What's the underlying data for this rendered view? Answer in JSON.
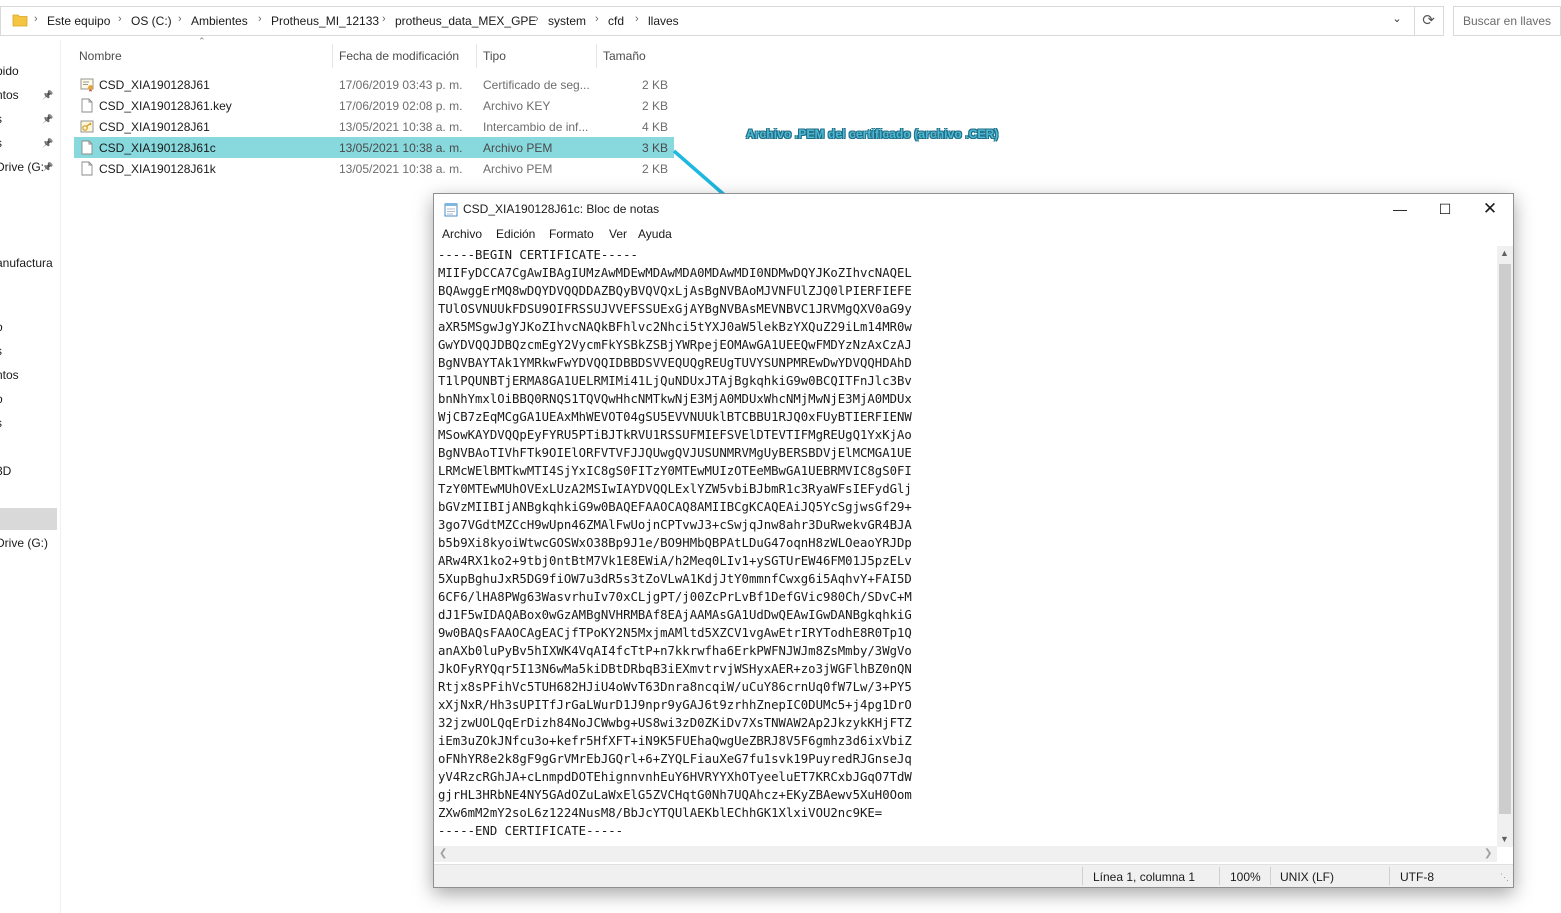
{
  "address": {
    "crumbs": [
      "Este equipo",
      "OS (C:)",
      "Ambientes",
      "Protheus_MI_12133",
      "protheus_data_MEX_GPE",
      "system",
      "cfd",
      "llaves"
    ],
    "search_placeholder": "Buscar en llaves"
  },
  "nav": {
    "items": [
      "pido",
      "ntos",
      "s",
      "s",
      "Drive (G:",
      "anufactura",
      "o",
      "s",
      "ntos",
      "o",
      "s",
      "3D",
      "Drive (G:)"
    ]
  },
  "columns": {
    "name": "Nombre",
    "date": "Fecha de modificación",
    "type": "Tipo",
    "size": "Tamaño"
  },
  "files": [
    {
      "name": "CSD_XIA190128J61",
      "date": "17/06/2019 03:43 p. m.",
      "type": "Certificado de seg...",
      "size": "2 KB",
      "icon": "certificate-icon"
    },
    {
      "name": "CSD_XIA190128J61.key",
      "date": "17/06/2019 02:08 p. m.",
      "type": "Archivo KEY",
      "size": "2 KB",
      "icon": "file-icon"
    },
    {
      "name": "CSD_XIA190128J61",
      "date": "13/05/2021 10:38 a. m.",
      "type": "Intercambio de inf...",
      "size": "4 KB",
      "icon": "pfx-icon"
    },
    {
      "name": "CSD_XIA190128J61c",
      "date": "13/05/2021 10:38 a. m.",
      "type": "Archivo PEM",
      "size": "3 KB",
      "icon": "file-icon",
      "selected": true
    },
    {
      "name": "CSD_XIA190128J61k",
      "date": "13/05/2021 10:38 a. m.",
      "type": "Archivo PEM",
      "size": "2 KB",
      "icon": "file-icon"
    }
  ],
  "annotation": "Archivo .PEM del certificado (archivo .CER)",
  "notepad": {
    "title": "CSD_XIA190128J61c: Bloc de notas",
    "menu": [
      "Archivo",
      "Edición",
      "Formato",
      "Ver",
      "Ayuda"
    ],
    "lines": [
      "-----BEGIN CERTIFICATE-----",
      "MIIFyDCCA7CgAwIBAgIUMzAwMDEwMDAwMDA0MDAwMDI0NDMwDQYJKoZIhvcNAQEL",
      "BQAwggErMQ8wDQYDVQQDDAZBQyBVQVQxLjAsBgNVBAoMJVNFUlZJQ0lPIERFIEFE",
      "TUlOSVNUUkFDSU9OIFRSSUJVVEFSSUExGjAYBgNVBAsMEVNBVC1JRVMgQXV0aG9y",
      "aXR5MSgwJgYJKoZIhvcNAQkBFhlvc2Nhci5tYXJ0aW5lekBzYXQuZ29iLm14MR0w",
      "GwYDVQQJDBQzcmEgY2VycmFkYSBkZSBjYWRpejEOMAwGA1UEEQwFMDYzNzAxCzAJ",
      "BgNVBAYTAk1YMRkwFwYDVQQIDBBDSVVEQUQgREUgTUVYSUNPMREwDwYDVQQHDAhD",
      "T1lPQUNBTjERMA8GA1UELRMIMi41LjQuNDUxJTAjBgkqhkiG9w0BCQITFnJlc3Bv",
      "bnNhYmxlOiBBQ0RNQS1TQVQwHhcNMTkwNjE3MjA0MDUxWhcNMjMwNjE3MjA0MDUx",
      "WjCB7zEqMCgGA1UEAxMhWEVOT04gSU5EVVNUUklBTCBBU1RJQ0xFUyBTIERFIENW",
      "MSowKAYDVQQpEyFYRU5PTiBJTkRVU1RSSUFMIEFSVElDTEVTIFMgREUgQ1YxKjAo",
      "BgNVBAoTIVhFTk9OIElORFVTVFJJQUwgQVJUSUNMRVMgUyBERSBDVjElMCMGA1UE",
      "LRMcWElBMTkwMTI4SjYxIC8gS0FITzY0MTEwMUIzOTEeMBwGA1UEBRMVIC8gS0FI",
      "TzY0MTEwMUhOVExLUzA2MSIwIAYDVQQLExlYZW5vbiBJbmR1c3RyaWFsIEFydGlj",
      "bGVzMIIBIjANBgkqhkiG9w0BAQEFAAOCAQ8AMIIBCgKCAQEAiJQ5YcSgjwsGf29+",
      "3go7VGdtMZCcH9wUpn46ZMAlFwUojnCPTvwJ3+cSwjqJnw8ahr3DuRwekvGR4BJA",
      "b5b9Xi8kyoiWtwcGOSWxO38Bp9J1e/BO9HMbQBPAtLDuG47oqnH8zWLOeaoYRJDp",
      "ARw4RX1ko2+9tbj0ntBtM7Vk1E8EWiA/h2Meq0LIv1+ySGTUrEW46FM01J5pzELv",
      "5XupBghuJxR5DG9fiOW7u3dR5s3tZoVLwA1KdjJtY0mmnfCwxg6i5AqhvY+FAI5D",
      "6CF6/lHA8PWg63WasvrhuIv70xCLjgPT/j00ZcPrLvBf1DefGVic980Ch/SDvC+M",
      "dJ1F5wIDAQABox0wGzAMBgNVHRMBAf8EAjAAMAsGA1UdDwQEAwIGwDANBgkqhkiG",
      "9w0BAQsFAAOCAgEACjfTPoKY2N5MxjmAMltd5XZCV1vgAwEtrIRYTodhE8R0Tp1Q",
      "anAXb0luPyBv5hIXWK4VqAI4fcTtP+n7kkrwfha6ErkPWFNJWJm8ZsMmby/3WgVo",
      "JkOFyRYQqr5I13N6wMa5kiDBtDRbqB3iEXmvtrvjWSHyxAER+zo3jWGFlhBZ0nQN",
      "Rtjx8sPFihVc5TUH682HJiU4oWvT63Dnra8ncqiW/uCuY86crnUq0fW7Lw/3+PY5",
      "xXjNxR/Hh3sUPITfJrGaLWurD1J9npr9yGAJ6t9zrhhZnepIC0DUMc5+j4pg1DrO",
      "32jzwUOLQqErDizh84NoJCWwbg+US8wi3zD0ZKiDv7XsTNWAW2Ap2JkzykKHjFTZ",
      "iEm3uZOkJNfcu3o+kefr5HfXFT+iN9K5FUEhaQwgUeZBRJ8V5F6gmhz3d6ixVbiZ",
      "oFNhYR8e2k8gF9gGrVMrEbJGQrl+6+ZYQLFiauXeG7fu1svk19PuyredRJGnseJq",
      "yV4RzcRGhJA+cLnmpdDOTEhignnvnhEuY6HVRYYXhOTyeeluET7KRCxbJGqO7TdW",
      "gjrHL3HRbNE4NY5GAdOZuLaWxElG5ZVCHqtG0Nh7UQAhcz+EKyZBAewv5XuH0Oom",
      "ZXw6mM2mY2soL6z1224NusM8/BbJcYTQUlAEKblEChhGK1XlxiVOU2nc9KE=",
      "-----END CERTIFICATE-----"
    ],
    "status": {
      "position": "Línea 1, columna 1",
      "zoom": "100%",
      "eol": "UNIX (LF)",
      "encoding": "UTF-8"
    }
  }
}
